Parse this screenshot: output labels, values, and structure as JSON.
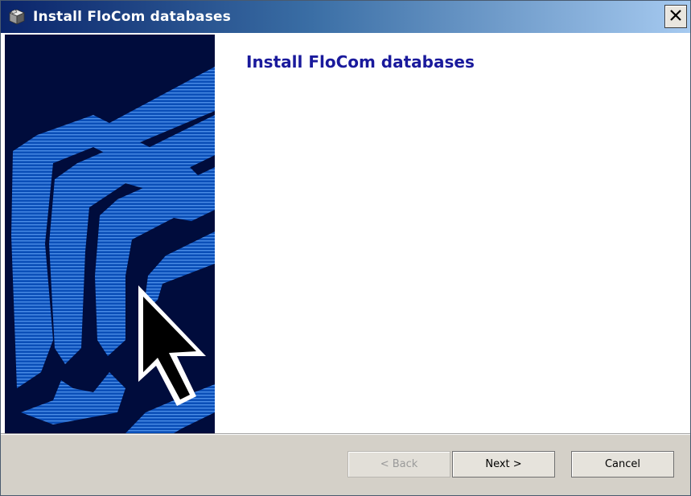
{
  "window": {
    "title": "Install FloCom databases",
    "title_icon": "installer-box-icon",
    "close_icon": "close-icon"
  },
  "main": {
    "heading": "Install FloCom databases"
  },
  "banner": {
    "image": "wizard-banner-cursor-graphic",
    "colors": {
      "background": "#000c3c",
      "stripe": "#2a6fd6"
    }
  },
  "buttons": {
    "back_label": "< Back",
    "back_enabled": false,
    "next_label": "Next >",
    "cancel_label": "Cancel"
  },
  "colors": {
    "title_gradient_start": "#0a246a",
    "title_gradient_end": "#a6caf0",
    "heading": "#1a1a9c",
    "dialog_face": "#d4d0c8"
  }
}
